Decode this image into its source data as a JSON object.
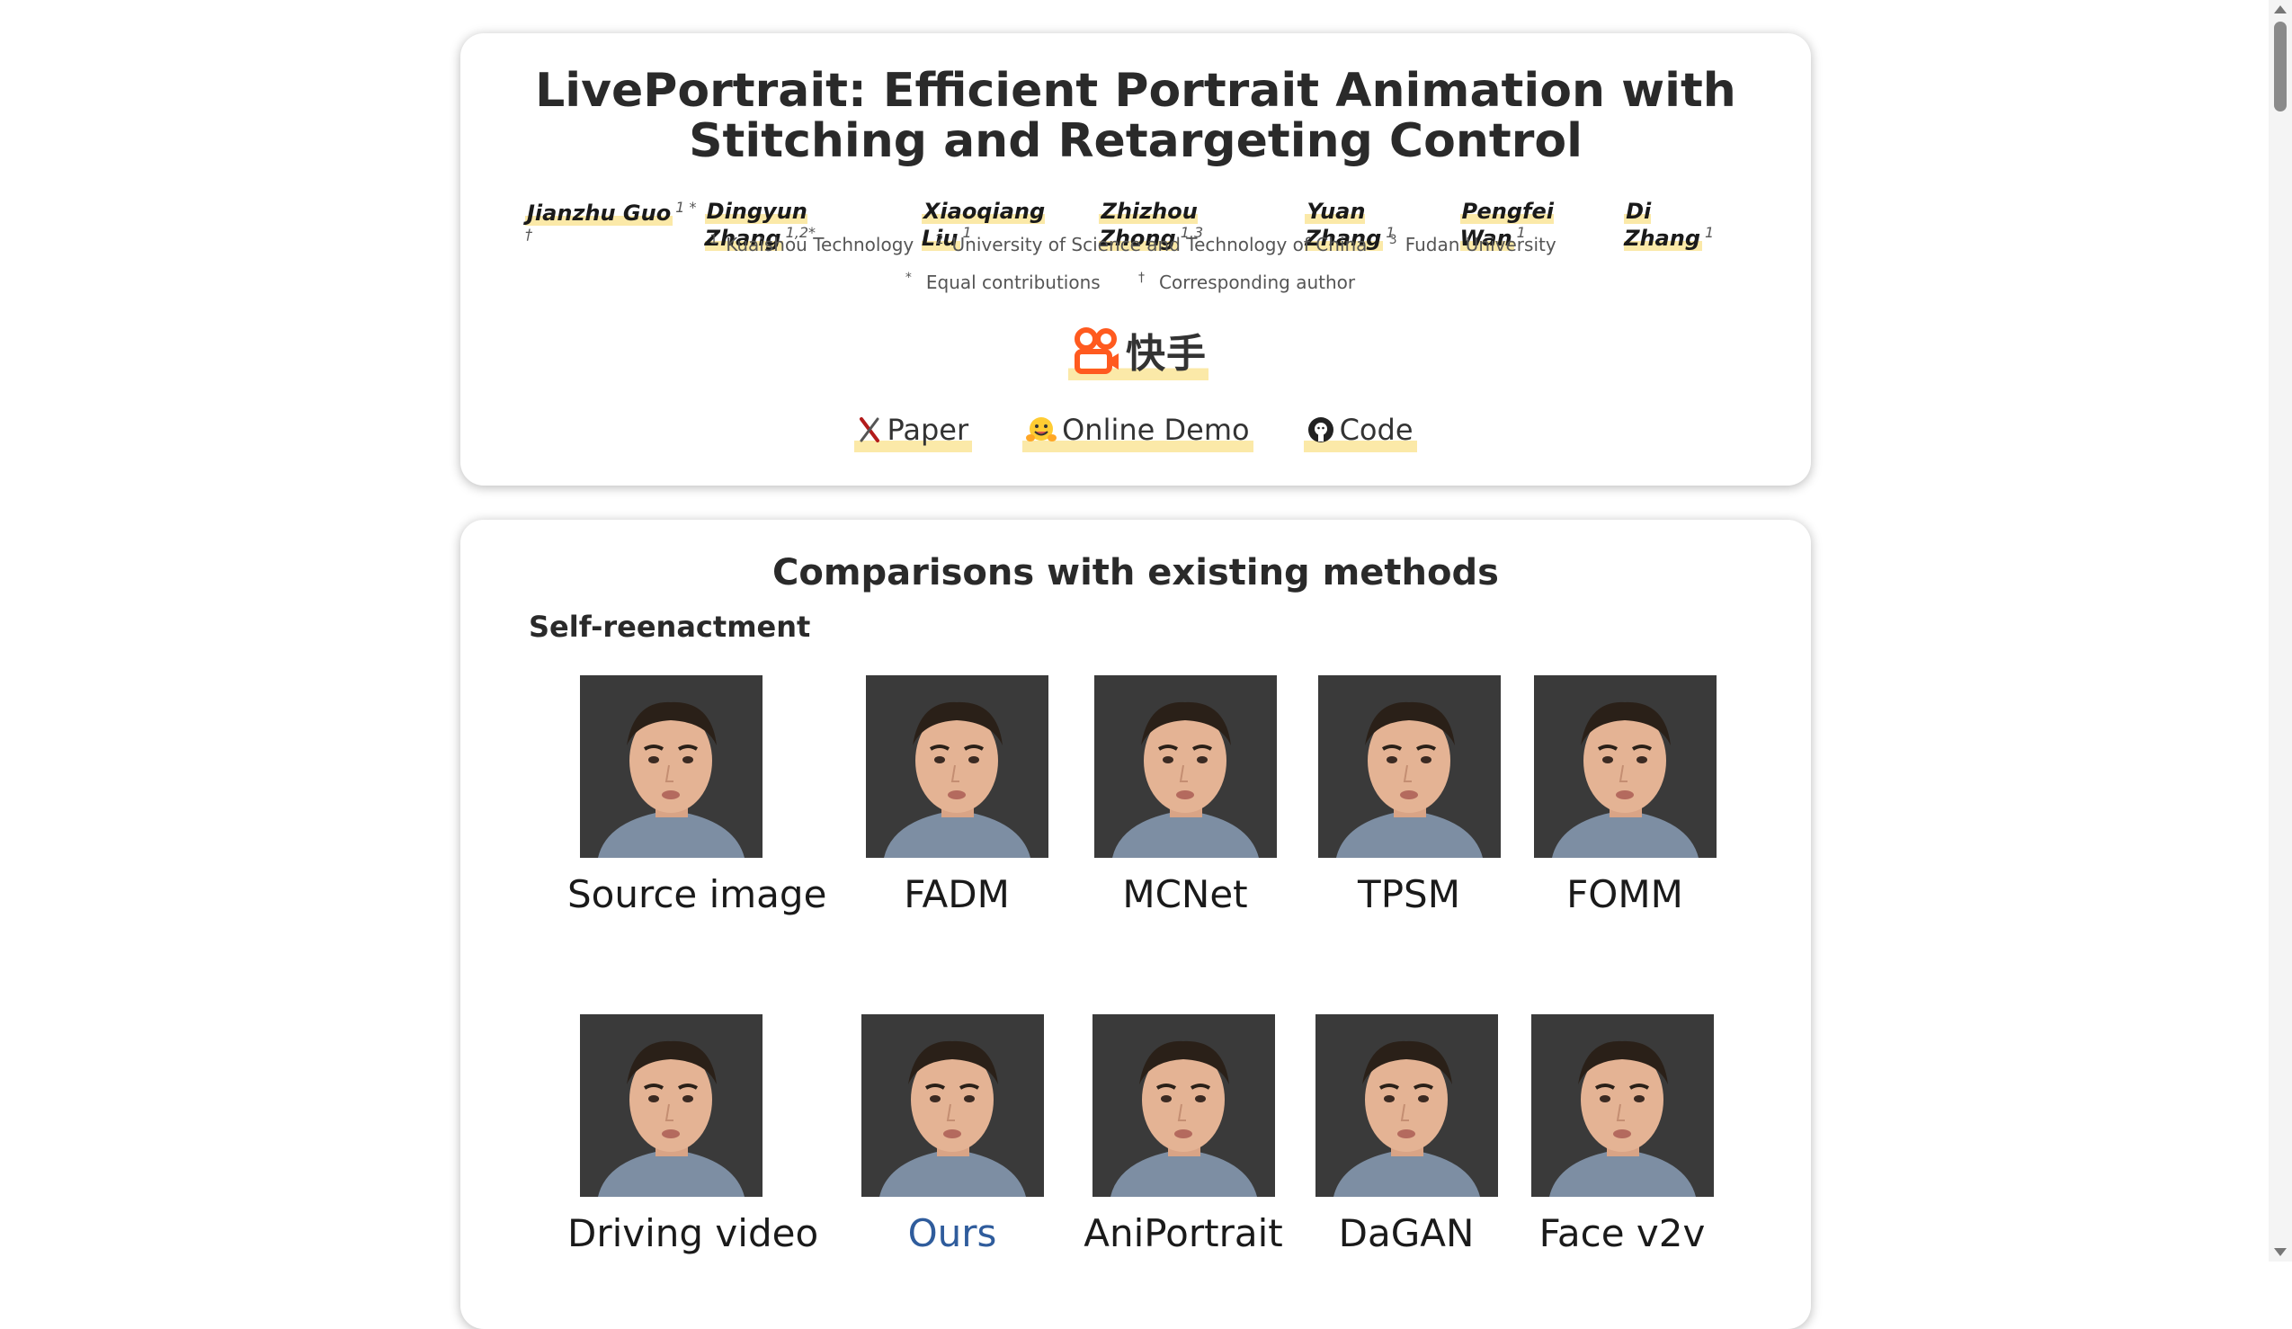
{
  "header": {
    "title": "LivePortrait: Efficient Portrait Animation with Stitching and Retargeting Control",
    "authors": [
      {
        "name": "Jianzhu Guo",
        "sup": "1 * †"
      },
      {
        "name": "Dingyun Zhang",
        "sup": "1,2*"
      },
      {
        "name": "Xiaoqiang Liu",
        "sup": "1"
      },
      {
        "name": "Zhizhou Zhong",
        "sup": "1,3"
      },
      {
        "name": "Yuan Zhang",
        "sup": "1"
      },
      {
        "name": "Pengfei Wan",
        "sup": "1"
      },
      {
        "name": "Di Zhang",
        "sup": "1"
      }
    ],
    "affiliations": [
      {
        "sup": "1",
        "name": "Kuaishou Technology"
      },
      {
        "sup": "2",
        "name": "University of Science and Technology of China"
      },
      {
        "sup": "3",
        "name": "Fudan University"
      }
    ],
    "notes": [
      {
        "sup": "*",
        "text": "Equal contributions"
      },
      {
        "sup": "†",
        "text": "Corresponding author"
      }
    ],
    "logo_text": "快手",
    "links": [
      {
        "label": "Paper",
        "icon": "arxiv-icon"
      },
      {
        "label": "Online Demo",
        "icon": "huggingface-icon"
      },
      {
        "label": "Code",
        "icon": "github-icon"
      }
    ]
  },
  "comparisons": {
    "title": "Comparisons with existing methods",
    "subtitle": "Self-reenactment",
    "row1": [
      "Source image",
      "FADM",
      "MCNet",
      "TPSM",
      "FOMM"
    ],
    "row2": [
      "Driving video",
      "Ours",
      "AniPortrait",
      "DaGAN",
      "Face v2v"
    ]
  },
  "colors": {
    "highlight": "#fbe9a8",
    "ours": "#2f5c9c",
    "kuaishou_orange": "#ff5a1f"
  }
}
